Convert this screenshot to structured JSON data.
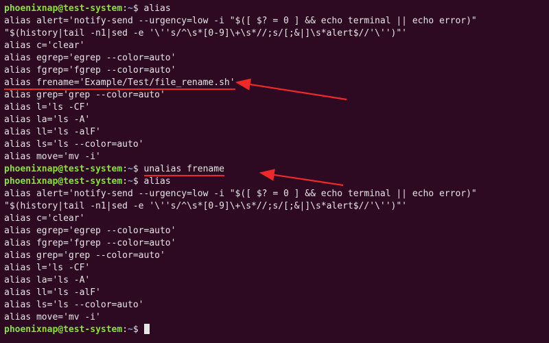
{
  "prompt": {
    "user": "phoenixnap",
    "at": "@",
    "host": "test-system",
    "path": "~",
    "dollar": "$"
  },
  "cmd1": "alias",
  "aliases1": [
    "alias alert='notify-send --urgency=low -i \"$([ $? = 0 ] && echo terminal || echo error)\"",
    "\"$(history|tail -n1|sed -e '\\''s/^\\s*[0-9]\\+\\s*//;s/[;&|]\\s*alert$//'\\'')\"'",
    "alias c='clear'",
    "alias egrep='egrep --color=auto'",
    "alias fgrep='fgrep --color=auto'"
  ],
  "frename_line": "alias frename='Example/Test/file_rename.sh'",
  "aliases1b": [
    "alias grep='grep --color=auto'",
    "alias l='ls -CF'",
    "alias la='ls -A'",
    "alias ll='ls -alF'",
    "alias ls='ls --color=auto'",
    "alias move='mv -i'"
  ],
  "cmd2": "unalias frename",
  "cmd3": "alias",
  "aliases2": [
    "alias alert='notify-send --urgency=low -i \"$([ $? = 0 ] && echo terminal || echo error)\"",
    "\"$(history|tail -n1|sed -e '\\''s/^\\s*[0-9]\\+\\s*//;s/[;&|]\\s*alert$//'\\'')\"'",
    "alias c='clear'",
    "alias egrep='egrep --color=auto'",
    "alias fgrep='fgrep --color=auto'",
    "alias grep='grep --color=auto'",
    "alias l='ls -CF'",
    "alias la='ls -A'",
    "alias ll='ls -alF'",
    "alias ls='ls --color=auto'",
    "alias move='mv -i'"
  ],
  "colors": {
    "bg": "#2d0922",
    "fg": "#e6e6e6",
    "user": "#8ae234",
    "path": "#729fcf",
    "annot": "#ef2929"
  }
}
